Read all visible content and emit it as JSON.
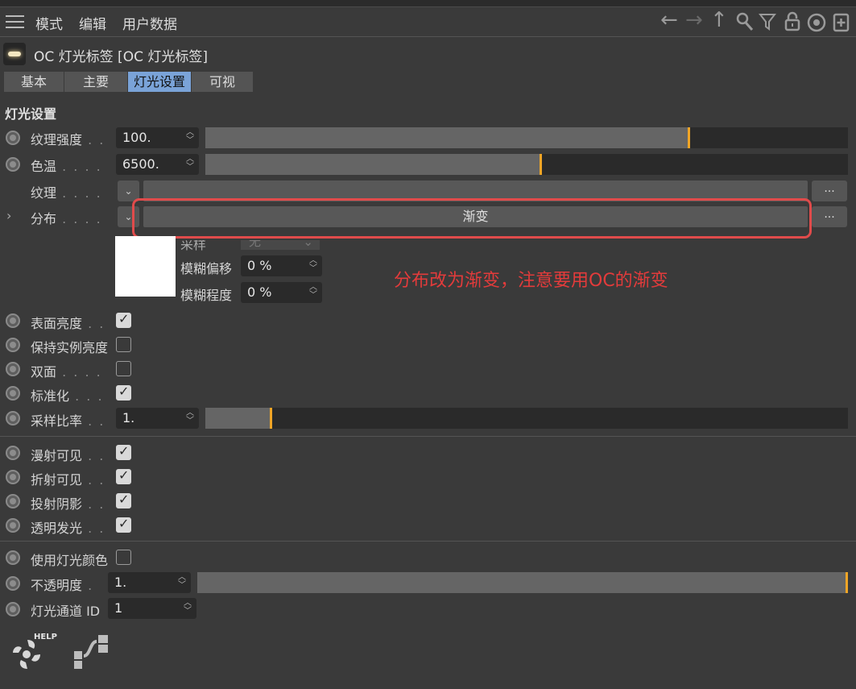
{
  "menu": {
    "items": [
      "模式",
      "编辑",
      "用户数据"
    ]
  },
  "toolbar_icons": [
    "back-arrow-icon",
    "forward-arrow-icon",
    "up-arrow-icon",
    "search-icon",
    "filter-icon",
    "lock-icon",
    "target-icon",
    "new-panel-icon"
  ],
  "object": {
    "title": "OC 灯光标签 [OC 灯光标签]"
  },
  "tabs": [
    "基本",
    "主要",
    "灯光设置",
    "可视"
  ],
  "active_tab": "灯光设置",
  "section_title": "灯光设置",
  "params": {
    "texture_strength": {
      "label": "纹理强度",
      "value": "100.",
      "slider_fraction": 0.75
    },
    "color_temp": {
      "label": "色温",
      "value": "6500.",
      "slider_fraction": 0.52
    },
    "texture": {
      "label": "纹理"
    },
    "distribution": {
      "label": "分布",
      "button": "渐变"
    },
    "sampling": {
      "label": "采样",
      "value": "无"
    },
    "blur_offset": {
      "label": "模糊偏移",
      "value": "0 %"
    },
    "blur_degree": {
      "label": "模糊程度",
      "value": "0 %"
    },
    "surface_brightness": {
      "label": "表面亮度",
      "checked": true
    },
    "keep_instance_brightness": {
      "label": "保持实例亮度",
      "checked": false
    },
    "double_sided": {
      "label": "双面",
      "checked": false
    },
    "normalize": {
      "label": "标准化",
      "checked": true
    },
    "sample_rate": {
      "label": "采样比率",
      "value": "1.",
      "slider_fraction": 0.1
    },
    "diffuse_visible": {
      "label": "漫射可见",
      "checked": true
    },
    "refraction_visible": {
      "label": "折射可见",
      "checked": true
    },
    "cast_shadows": {
      "label": "投射阴影",
      "checked": true
    },
    "transparent_emission": {
      "label": "透明发光",
      "checked": true
    },
    "use_light_color": {
      "label": "使用灯光颜色",
      "checked": false
    },
    "opacity": {
      "label": "不透明度",
      "value": "1.",
      "slider_fraction": 1.0
    },
    "light_pass_id": {
      "label": "灯光通道 ID",
      "value": "1"
    }
  },
  "more_label": "...",
  "help_label": "HELP",
  "annotation": "分布改为渐变，注意要用OC的渐变",
  "colors": {
    "accent": "#f0a526",
    "tab_active": "#7aa3d8",
    "annotation": "#e33b3b"
  }
}
